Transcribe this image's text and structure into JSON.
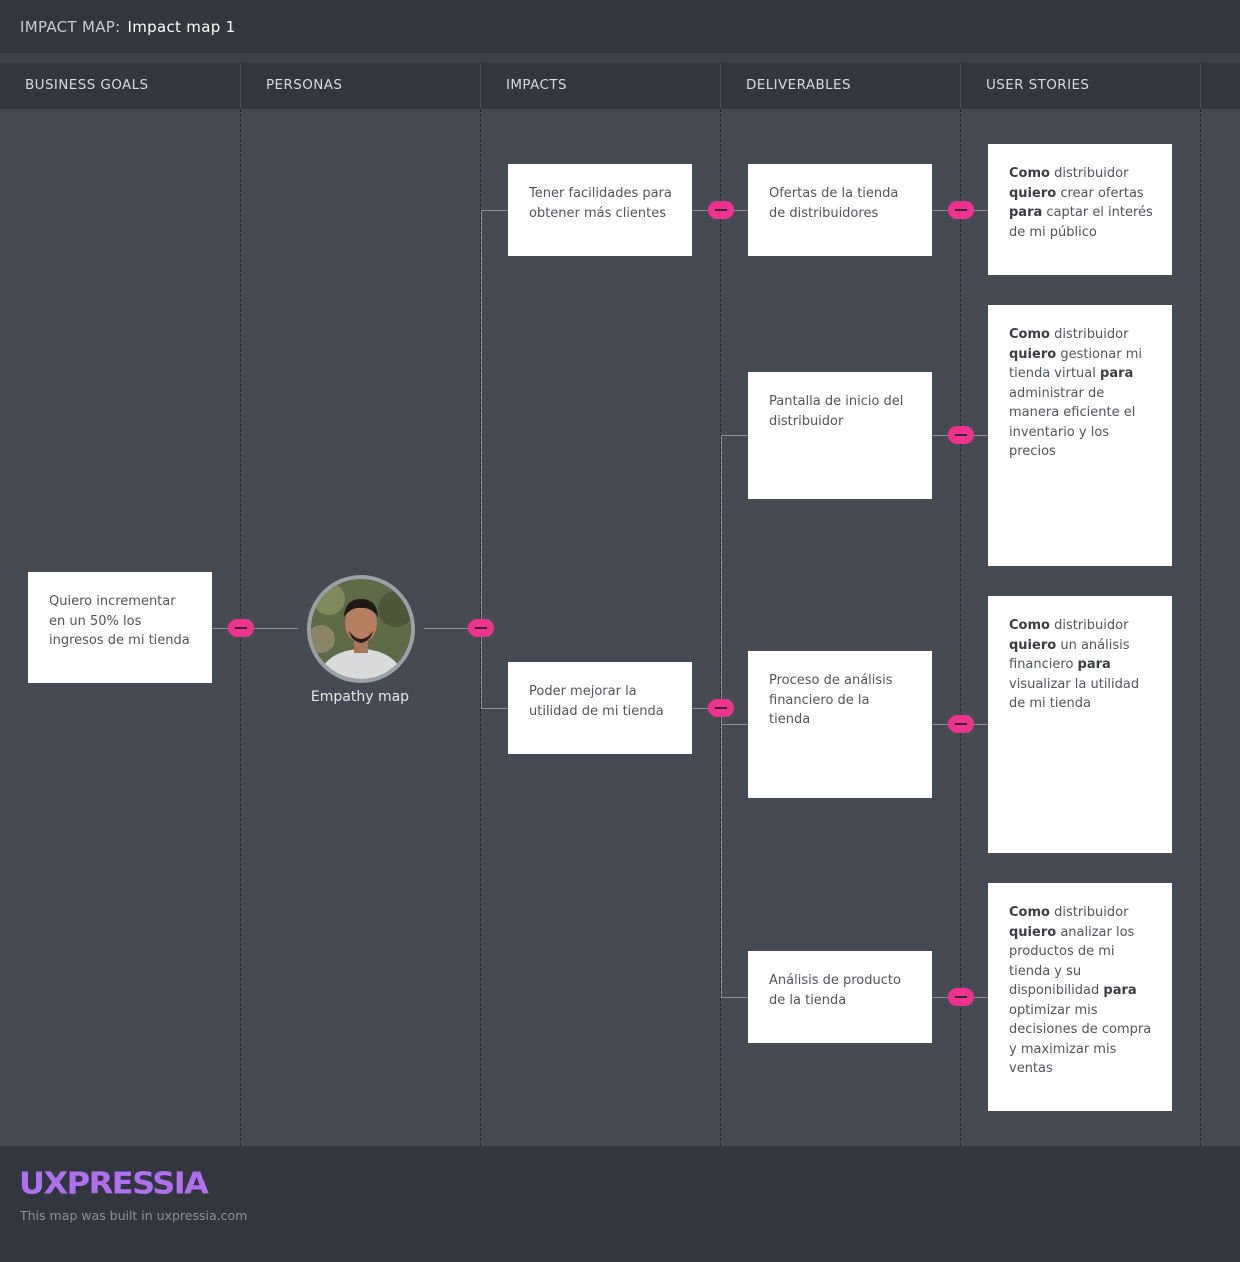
{
  "header": {
    "label": "IMPACT MAP:",
    "title": "Impact map 1"
  },
  "columns": [
    "BUSINESS GOALS",
    "PERSONAS",
    "IMPACTS",
    "DELIVERABLES",
    "USER STORIES"
  ],
  "goal": {
    "text": "Quiero incrementar en un 50% los ingresos de mi tienda"
  },
  "persona": {
    "name": "Empathy map",
    "avatar_icon": "person-photo-icon"
  },
  "impacts": [
    {
      "text": "Tener facilidades para obtener más clientes"
    },
    {
      "text": "Poder mejorar la utilidad de mi tienda"
    }
  ],
  "deliverables": [
    {
      "text": "Ofertas de la tienda de distribuidores"
    },
    {
      "text": "Pantalla de inicio del distribuidor"
    },
    {
      "text": "Proceso de análisis financiero de la tienda"
    },
    {
      "text": "Análisis de producto de la tienda"
    }
  ],
  "stories": [
    {
      "k1": "Como",
      "t1": "distribuidor",
      "k2": "quiero",
      "t2": "crear ofertas",
      "k3": "para",
      "t3": "captar el interés de mi público"
    },
    {
      "k1": "Como",
      "t1": "distribuidor",
      "k2": "quiero",
      "t2": "gestionar mi tienda virtual",
      "k3": "para",
      "t3": "administrar de manera eficiente el inventario y los precios"
    },
    {
      "k1": "Como",
      "t1": "distribuidor",
      "k2": "quiero",
      "t2": "un análisis financiero",
      "k3": "para",
      "t3": "visualizar la utilidad de mi tienda"
    },
    {
      "k1": "Como",
      "t1": "distribuidor",
      "k2": "quiero",
      "t2": "analizar los productos de mi tienda y su disponibilidad",
      "k3": "para",
      "t3": "optimizar mis decisiones de compra y maximizar mis ventas"
    }
  ],
  "footer": {
    "logo": "UXPRESSIA",
    "note": "This map was built in uxpressia.com"
  },
  "colors": {
    "accent": "#f0328f",
    "logo": "#b06ff0"
  }
}
